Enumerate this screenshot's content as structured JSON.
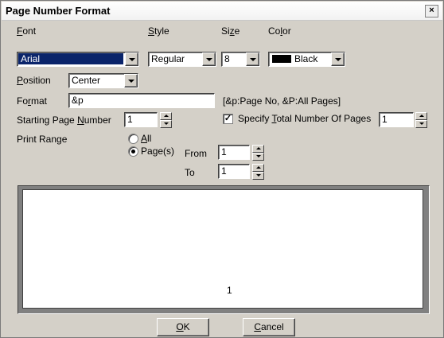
{
  "dialog": {
    "title": "Page Number Format",
    "close": "×"
  },
  "font": {
    "label_accel": "F",
    "label_rest": "ont",
    "value": "Arial"
  },
  "style": {
    "label_accel": "S",
    "label_rest": "tyle",
    "value": "Regular"
  },
  "size": {
    "label_pre": "Si",
    "label_accel": "z",
    "label_rest": "e",
    "value": "8"
  },
  "color": {
    "label_pre": "Co",
    "label_accel": "l",
    "label_rest": "or",
    "value": "Black",
    "swatch": "#000000"
  },
  "position": {
    "label_accel": "P",
    "label_rest": "osition",
    "value": "Center"
  },
  "format": {
    "label_pre": "Fo",
    "label_accel": "r",
    "label_rest": "mat",
    "value": "&p",
    "hint": "[&p:Page No, &P:All Pages]"
  },
  "starting_page": {
    "label_pre": "Starting Page ",
    "label_accel": "N",
    "label_rest": "umber",
    "value": "1"
  },
  "total_pages": {
    "checked": true,
    "check_glyph": "✓",
    "label_pre": "Specify ",
    "label_accel": "T",
    "label_rest": "otal Number Of Pages",
    "value": "1"
  },
  "print_range": {
    "label": "Print Range",
    "all_accel": "A",
    "all_rest": "ll",
    "pages_pre": "Pa",
    "pages_accel": "g",
    "pages_rest": "e(s)",
    "selected": "pages",
    "from_label": "From",
    "from_value": "1",
    "to_label": "To",
    "to_value": "1"
  },
  "preview": {
    "page_number": "1"
  },
  "buttons": {
    "ok_accel": "O",
    "ok_rest": "K",
    "cancel_accel": "C",
    "cancel_rest": "ancel"
  }
}
